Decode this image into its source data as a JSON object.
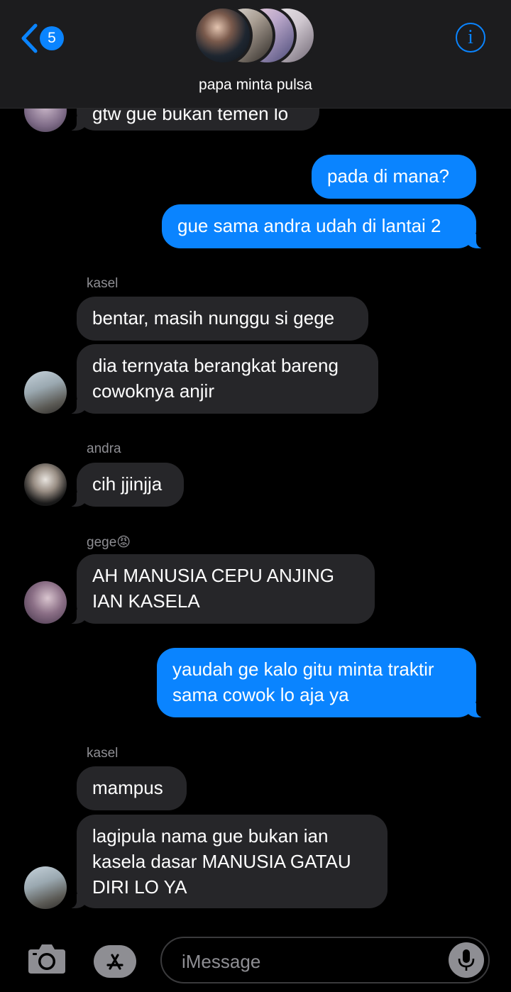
{
  "header": {
    "unread_count": "5",
    "group_name": "papa minta pulsa",
    "info_glyph": "i"
  },
  "messages": [
    {
      "text": "gtw gue bukan temen lo"
    },
    {
      "text": "pada di mana?"
    },
    {
      "text": "gue sama andra udah di lantai 2"
    },
    {
      "sender": "kasel",
      "text": "bentar, masih nunggu si gege"
    },
    {
      "text": "dia ternyata berangkat bareng\ncowoknya anjir"
    },
    {
      "sender": "andra",
      "text": "cih jjinjja"
    },
    {
      "sender": "gege😡",
      "text": "AH MANUSIA CEPU ANJING\nIAN KASELA"
    },
    {
      "text": "yaudah ge kalo gitu minta traktir\nsama cowok lo aja ya"
    },
    {
      "sender": "kasel",
      "text": "mampus"
    },
    {
      "text": "lagipula nama gue bukan ian\nkasela dasar MANUSIA GATAU\nDIRI LO YA"
    }
  ],
  "composer": {
    "placeholder": "iMessage"
  },
  "icons": [
    "back-chevron-icon",
    "info-icon",
    "camera-icon",
    "app-store-icon",
    "microphone-icon"
  ],
  "colors": {
    "accent": "#0a84ff",
    "incoming_bubble": "#262629",
    "header_bg": "#1c1c1e",
    "background": "#000000"
  }
}
